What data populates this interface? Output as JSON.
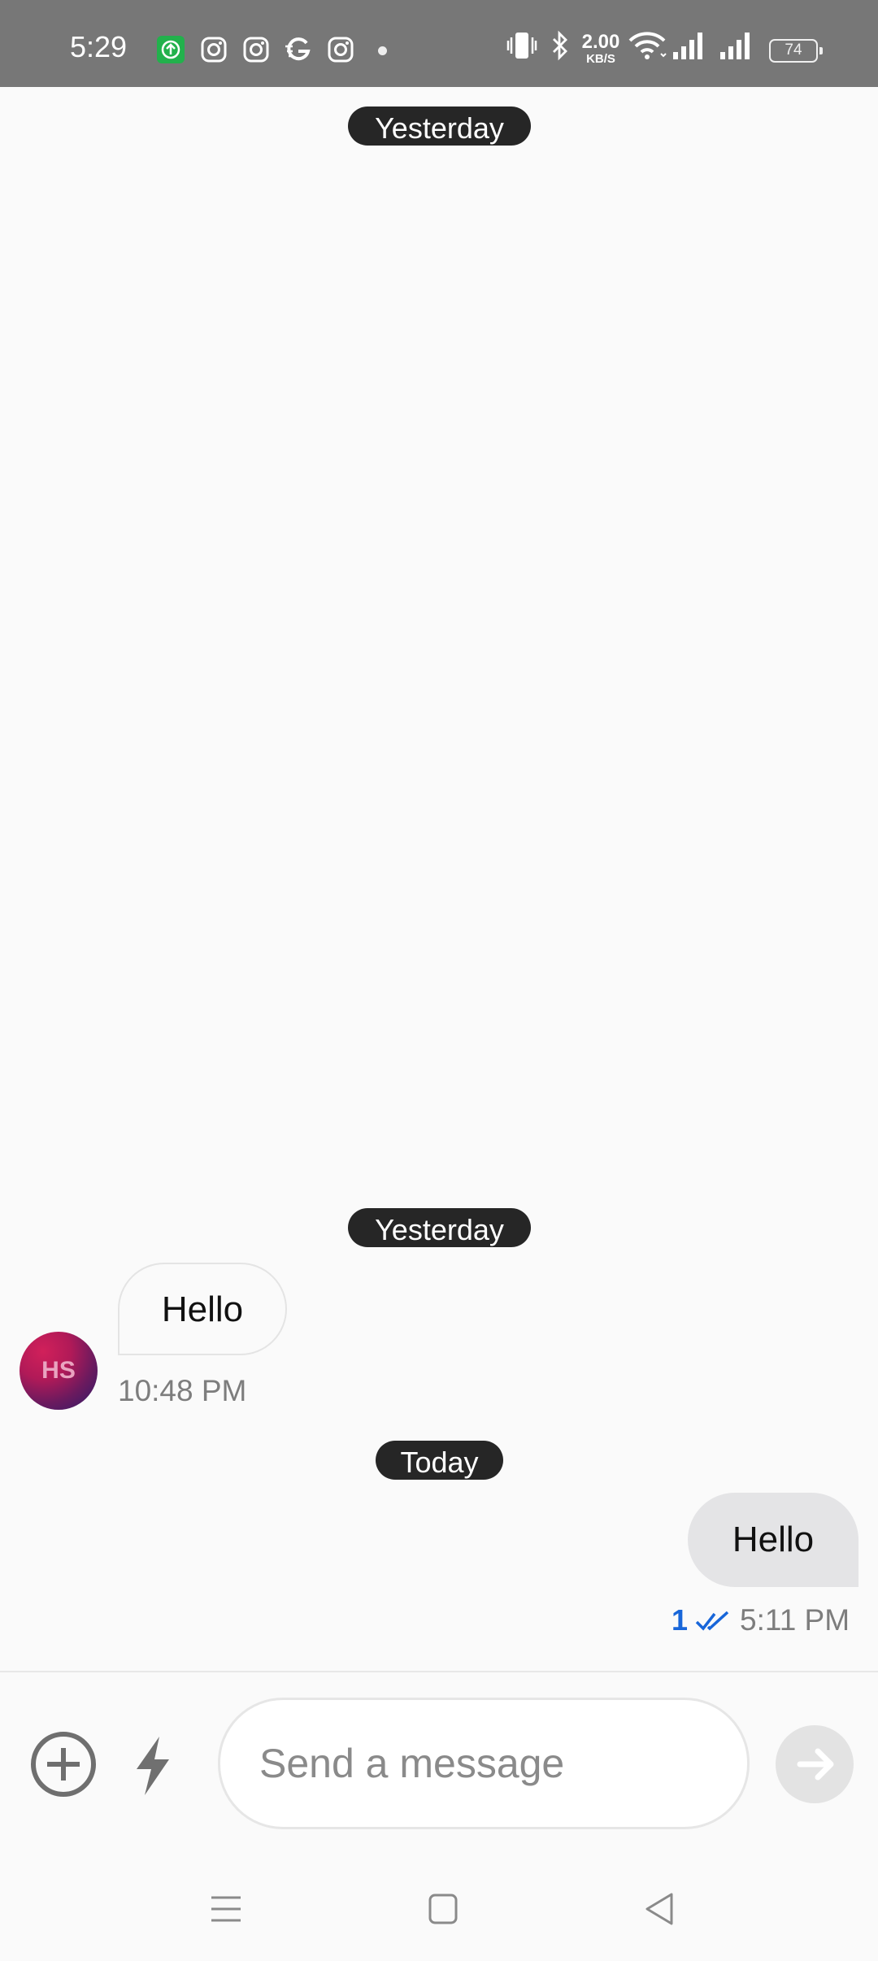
{
  "status_bar": {
    "time": "5:29",
    "net_speed_value": "2.00",
    "net_speed_unit": "KB/S",
    "battery_level": "74",
    "notification_icons": [
      "upload-app-icon",
      "instagram-icon",
      "instagram-icon",
      "g-app-icon",
      "instagram-icon"
    ],
    "system_icons": [
      "vibrate-icon",
      "bluetooth-icon",
      "wifi-icon",
      "signal-icon",
      "signal-icon"
    ]
  },
  "chat": {
    "date_separators": [
      "Yesterday",
      "Yesterday",
      "Today"
    ],
    "incoming": {
      "avatar_initials": "HS",
      "text": "Hello",
      "time": "10:48 PM"
    },
    "outgoing": {
      "text": "Hello",
      "read_count": "1",
      "time": "5:11 PM"
    }
  },
  "composer": {
    "placeholder": "Send a message",
    "value": ""
  },
  "colors": {
    "status_bar_bg": "#777777",
    "pill_bg": "#262626",
    "read_tick": "#1866d9",
    "outgoing_bubble": "#e4e4e6"
  }
}
